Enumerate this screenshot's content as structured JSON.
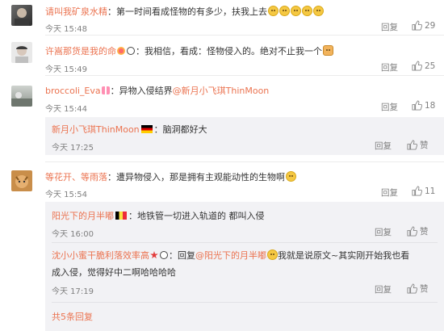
{
  "comments": [
    {
      "user": "请叫我矿泉水精",
      "text": "：第一时间看成怪物的有多少，扶我上去",
      "time": "今天 15:48",
      "reply": "回复",
      "likes": "29"
    },
    {
      "user": "许嵩那货是我的命",
      "text": "：我相信，看成：怪物侵入的。绝对不止我一个",
      "time": "今天 15:49",
      "reply": "回复",
      "likes": "25"
    },
    {
      "user": "broccoli_Eva",
      "text": "：异物入侵结界",
      "mention": "@新月小飞琪ThinMoon",
      "time": "今天 15:44",
      "reply": "回复",
      "likes": "18",
      "subreplies": [
        {
          "user": "新月小飞琪ThinMoon",
          "text": "：脑洞都好大",
          "time": "今天 17:25",
          "reply": "回复",
          "like": "赞"
        }
      ]
    },
    {
      "user": "等花开、等雨落",
      "text": "：遭异物侵入，那是拥有主观能动性的生物啊",
      "time": "今天 15:54",
      "reply": "回复",
      "likes": "11",
      "subreplies": [
        {
          "user": "阳光下的月半嘟",
          "text": "：地铁管一切进入轨道的 都叫入侵",
          "time": "今天 16:00",
          "reply": "回复",
          "like": "赞"
        },
        {
          "user": "沈小小蜜干脆利落效率高",
          "text_prefix": "：回复",
          "mention": "@阳光下的月半嘟",
          "text_line1": "我就是说原文~其实刚开始我也看",
          "text_line2": "成入侵，觉得好中二啊哈哈哈哈",
          "time": "今天 17:19",
          "reply": "回复",
          "like": "赞"
        }
      ],
      "more_link": "共5条回复"
    }
  ],
  "colors": {
    "username": "#eb7350",
    "muted": "#808080",
    "sub_background": "#f2f2f5"
  }
}
